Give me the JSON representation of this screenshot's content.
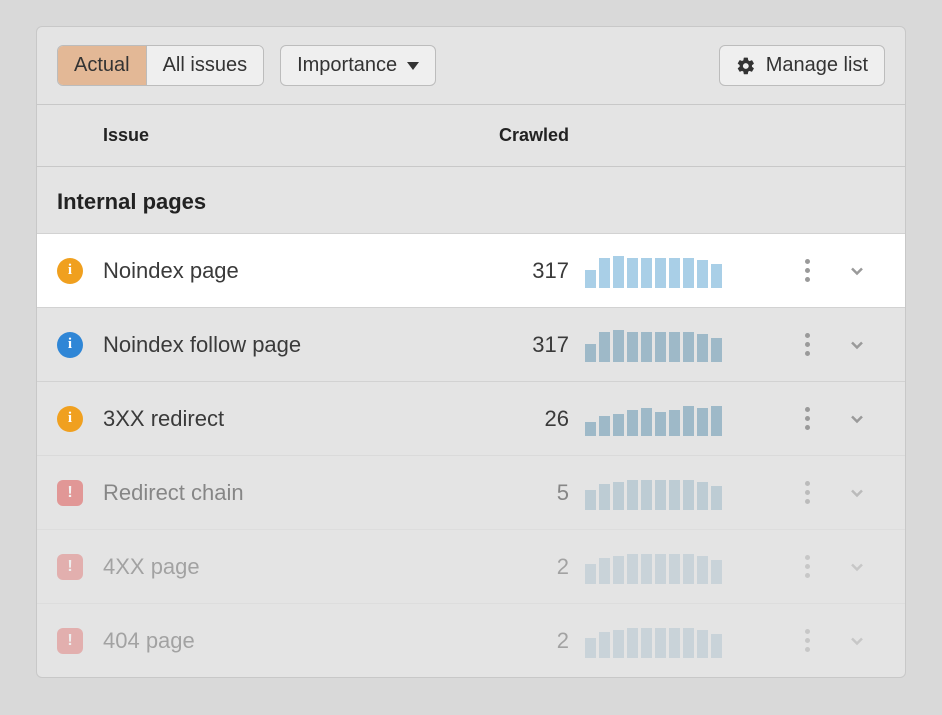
{
  "toolbar": {
    "segments": [
      {
        "label": "Actual",
        "active": true
      },
      {
        "label": "All issues",
        "active": false
      }
    ],
    "sort_label": "Importance",
    "manage_label": "Manage list"
  },
  "columns": {
    "issue": "Issue",
    "crawled": "Crawled"
  },
  "section_title": "Internal pages",
  "rows": [
    {
      "icon": "warning-orange",
      "name": "Noindex page",
      "crawled": 317,
      "spark": [
        18,
        30,
        32,
        30,
        30,
        30,
        30,
        30,
        28,
        24
      ],
      "highlight": true,
      "fade": 0
    },
    {
      "icon": "info-blue",
      "name": "Noindex follow page",
      "crawled": 317,
      "spark": [
        18,
        30,
        32,
        30,
        30,
        30,
        30,
        30,
        28,
        24
      ],
      "highlight": false,
      "fade": 0
    },
    {
      "icon": "warning-orange",
      "name": "3XX redirect",
      "crawled": 26,
      "spark": [
        14,
        20,
        22,
        26,
        28,
        24,
        26,
        30,
        28,
        30
      ],
      "highlight": false,
      "fade": 0
    },
    {
      "icon": "error-red",
      "name": "Redirect chain",
      "crawled": 5,
      "spark": [
        20,
        26,
        28,
        30,
        30,
        30,
        30,
        30,
        28,
        24
      ],
      "highlight": false,
      "fade": 1
    },
    {
      "icon": "error-red",
      "name": "4XX page",
      "crawled": 2,
      "spark": [
        20,
        26,
        28,
        30,
        30,
        30,
        30,
        30,
        28,
        24
      ],
      "highlight": false,
      "fade": 2
    },
    {
      "icon": "error-red",
      "name": "404 page",
      "crawled": 2,
      "spark": [
        20,
        26,
        28,
        30,
        30,
        30,
        30,
        30,
        28,
        24
      ],
      "highlight": false,
      "fade": 2
    }
  ]
}
